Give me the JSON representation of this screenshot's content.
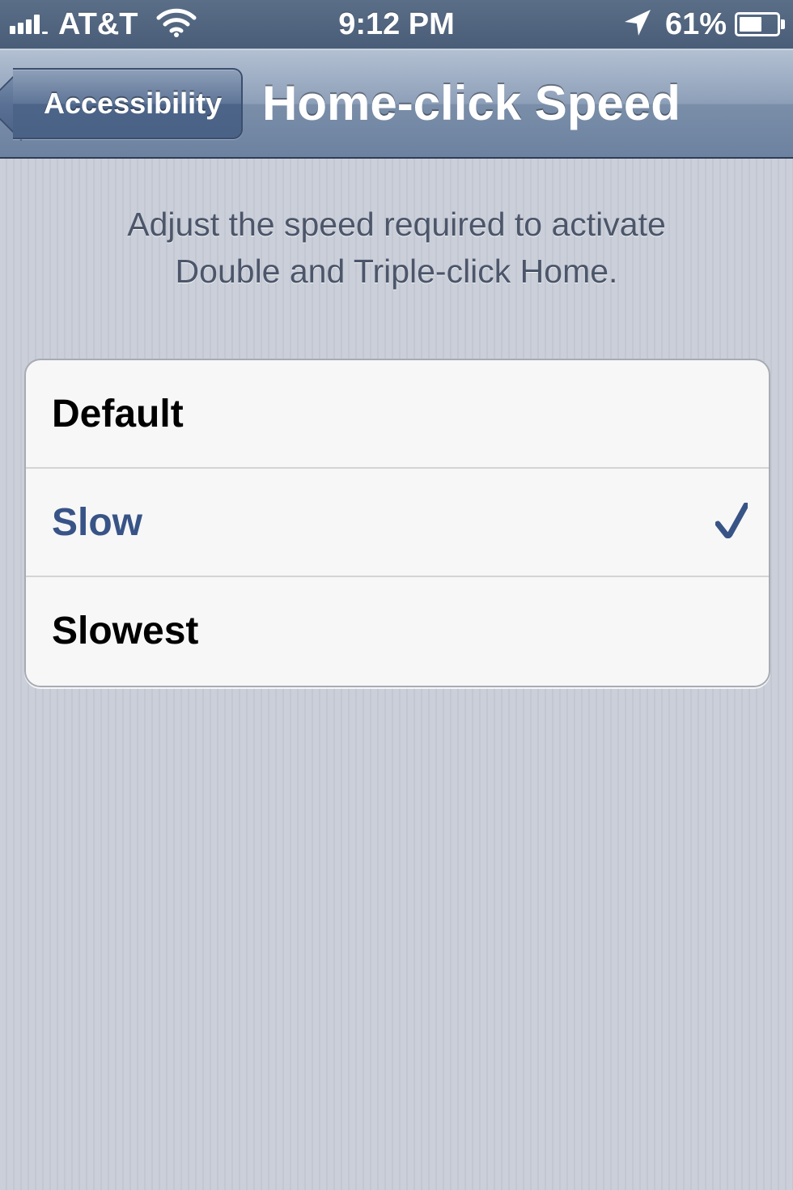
{
  "status_bar": {
    "carrier": "AT&T",
    "time": "9:12 PM",
    "battery_percent": "61%",
    "battery_level": 0.61,
    "signal_bars_active": 4,
    "icons": [
      "signal-bars-icon",
      "wifi-icon",
      "location-arrow-icon",
      "battery-icon"
    ]
  },
  "nav_bar": {
    "back_label": "Accessibility",
    "title": "Home-click Speed"
  },
  "description": {
    "line1": "Adjust the speed required to activate",
    "line2": "Double and Triple-click Home."
  },
  "options": [
    {
      "label": "Default",
      "selected": false
    },
    {
      "label": "Slow",
      "selected": true
    },
    {
      "label": "Slowest",
      "selected": false
    }
  ],
  "colors": {
    "selected_text": "#385487",
    "checkmark": "#385487",
    "nav_bar": "#6d82a0"
  }
}
